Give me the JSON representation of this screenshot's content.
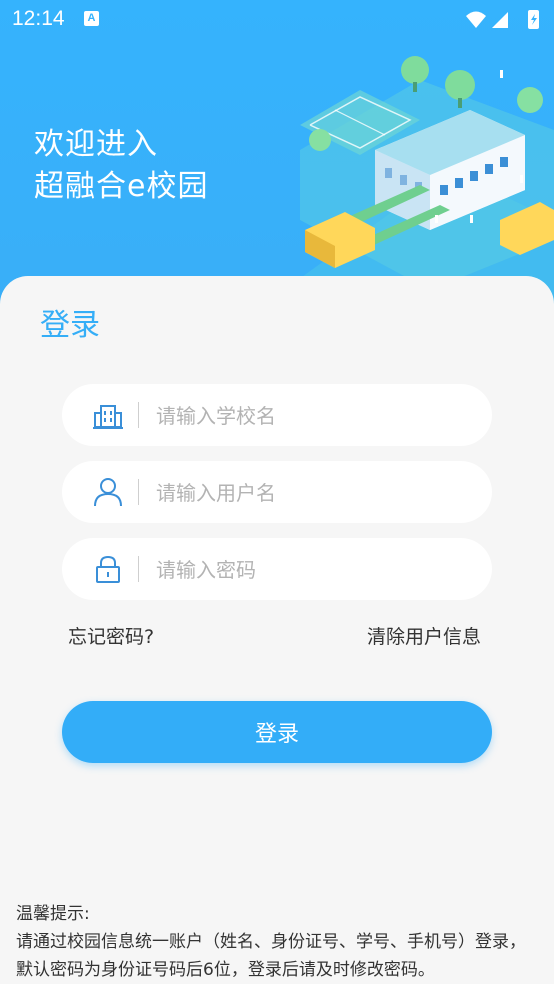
{
  "status_bar": {
    "time": "12:14",
    "notification_badge": "A"
  },
  "hero": {
    "welcome_line1": "欢迎进入",
    "welcome_line2": "超融合e校园"
  },
  "login": {
    "title": "登录",
    "school_placeholder": "请输入学校名",
    "username_placeholder": "请输入用户名",
    "password_placeholder": "请输入密码",
    "forgot_password": "忘记密码?",
    "clear_user_info": "清除用户信息",
    "submit_label": "登录"
  },
  "tips": {
    "heading": "温馨提示:",
    "body": "请通过校园信息统一账户（姓名、身份证号、学号、手机号）登录，默认密码为身份证号码后6位，登录后请及时修改密码。"
  },
  "colors": {
    "primary": "#35aef7",
    "hero_background": "#35b3fd",
    "page_background": "#f6f6f6"
  },
  "icons": {
    "school_field": "school-building-icon",
    "username_field": "user-icon",
    "password_field": "lock-icon"
  }
}
